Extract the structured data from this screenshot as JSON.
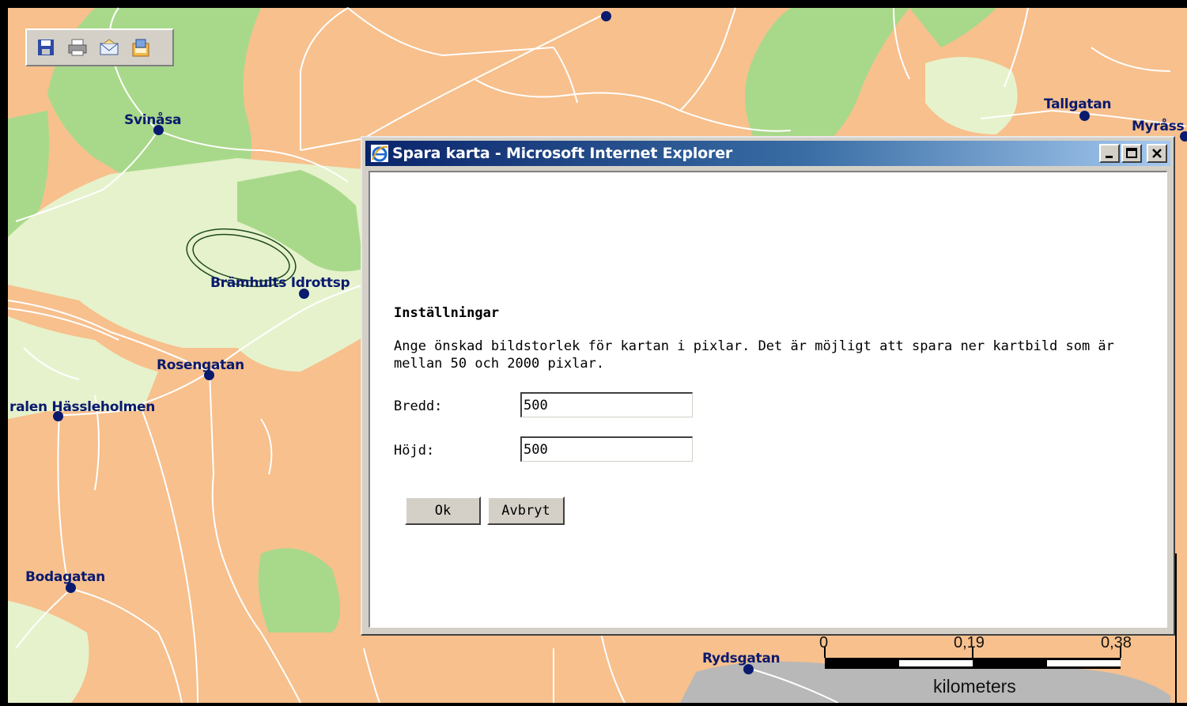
{
  "map": {
    "colors": {
      "urban": "#f7c08d",
      "park": "#a8d98a",
      "light_green": "#e6f2cc",
      "road": "#ffffff",
      "stop": "#0a1a6e",
      "rail_gray": "#b8b8b8"
    },
    "stops": [
      {
        "name": "Svinåsa"
      },
      {
        "name": "Brämhults Idrottsp"
      },
      {
        "name": "Rosengatan"
      },
      {
        "name": "ralen Hässleholmen"
      },
      {
        "name": "Bodagatan"
      },
      {
        "name": "Tallgatan"
      },
      {
        "name": "Myråss"
      },
      {
        "name": "Rydsgatan"
      }
    ],
    "scale": {
      "tick_0": "0",
      "tick_1": "0,19",
      "tick_2": "0,38",
      "unit": "kilometers"
    }
  },
  "toolbar": {
    "buttons": [
      {
        "icon": "save-icon",
        "label": "Spara"
      },
      {
        "icon": "print-icon",
        "label": "Skriv ut"
      },
      {
        "icon": "email-icon",
        "label": "E-post"
      },
      {
        "icon": "export-icon",
        "label": "Exportera"
      }
    ]
  },
  "dialog": {
    "title": "Spara karta - Microsoft Internet Explorer",
    "heading": "Inställningar",
    "description_line1": "Ange önskad bildstorlek för kartan i pixlar. Det är möjligt att spara ner kartbild som är",
    "description_line2": "mellan 50 och 2000 pixlar.",
    "width_label": "Bredd:",
    "width_value": "500",
    "height_label": "Höjd:",
    "height_value": "500",
    "ok_label": "Ok",
    "cancel_label": "Avbryt"
  }
}
